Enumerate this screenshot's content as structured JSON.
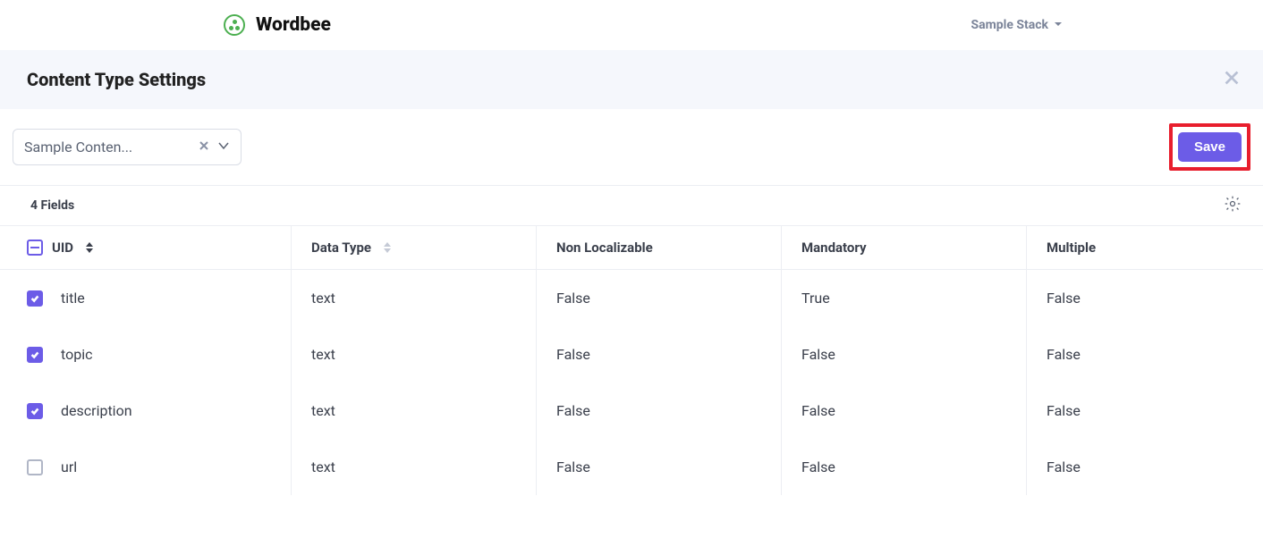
{
  "brand": {
    "name": "Wordbee"
  },
  "stack": {
    "label": "Sample Stack"
  },
  "settings": {
    "title": "Content Type Settings"
  },
  "contentType": {
    "selected": "Sample Conten..."
  },
  "actions": {
    "save": "Save"
  },
  "fieldCount": "4 Fields",
  "columns": {
    "uid": "UID",
    "dataType": "Data Type",
    "nonLocalizable": "Non Localizable",
    "mandatory": "Mandatory",
    "multiple": "Multiple"
  },
  "rows": [
    {
      "checked": true,
      "uid": "title",
      "dataType": "text",
      "nonLocalizable": "False",
      "mandatory": "True",
      "multiple": "False"
    },
    {
      "checked": true,
      "uid": "topic",
      "dataType": "text",
      "nonLocalizable": "False",
      "mandatory": "False",
      "multiple": "False"
    },
    {
      "checked": true,
      "uid": "description",
      "dataType": "text",
      "nonLocalizable": "False",
      "mandatory": "False",
      "multiple": "False"
    },
    {
      "checked": false,
      "uid": "url",
      "dataType": "text",
      "nonLocalizable": "False",
      "mandatory": "False",
      "multiple": "False"
    }
  ]
}
